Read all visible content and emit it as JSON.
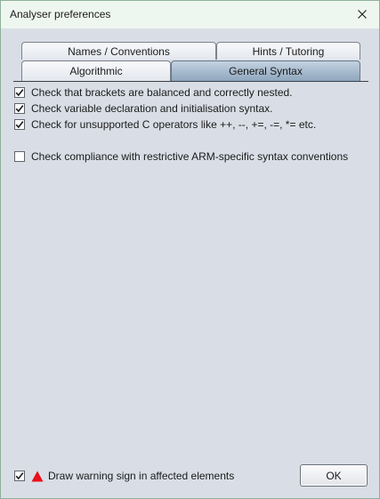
{
  "window": {
    "title": "Analyser preferences"
  },
  "tabs": {
    "back_row": [
      {
        "label": "Names / Conventions"
      },
      {
        "label": "Hints / Tutoring"
      }
    ],
    "front_row": [
      {
        "label": "Algorithmic"
      },
      {
        "label": "General Syntax",
        "active": true
      }
    ]
  },
  "options": [
    {
      "label": "Check that brackets are balanced and correctly nested.",
      "checked": true
    },
    {
      "label": "Check variable declaration and initialisation syntax.",
      "checked": true
    },
    {
      "label": "Check for unsupported C operators like ++, --, +=, -=, *= etc.",
      "checked": true
    },
    {
      "label": "Check compliance with restrictive ARM-specific syntax conventions",
      "checked": false
    }
  ],
  "footer": {
    "warning_label": "Draw warning sign in affected elements",
    "warning_checked": true,
    "ok_label": "OK"
  },
  "icons": {
    "close": "close-icon",
    "warning": "warning-triangle-icon",
    "warning_color": "#e8101a"
  }
}
